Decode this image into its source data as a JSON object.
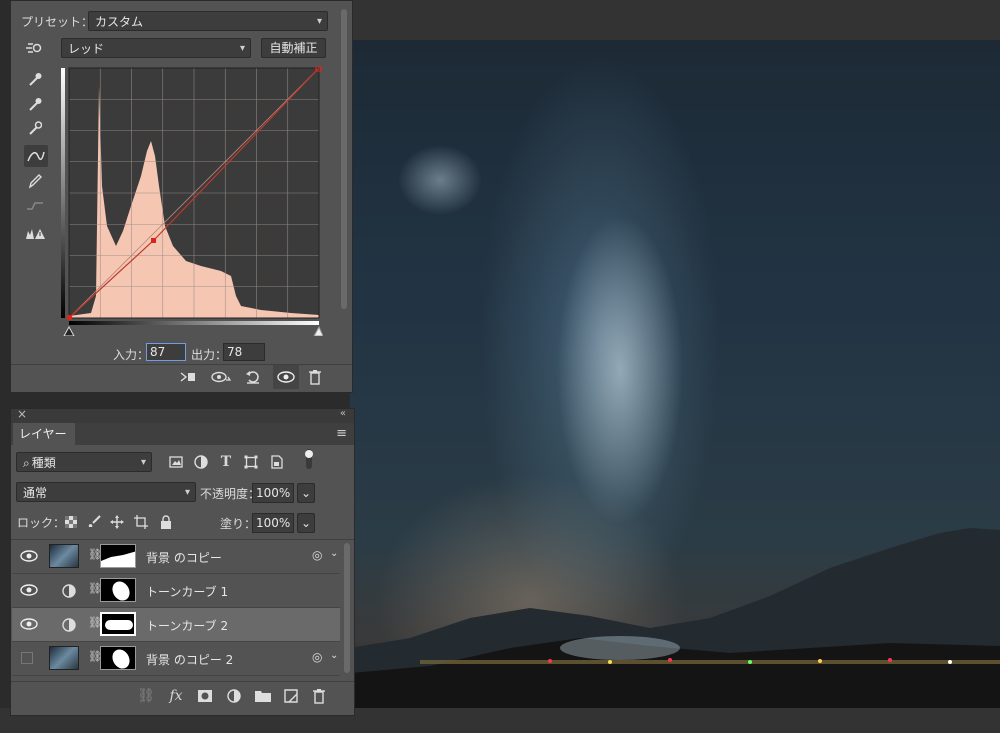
{
  "properties": {
    "preset_label": "プリセット：",
    "preset_value": "カスタム",
    "channel_value": "レッド",
    "auto_button": "自動補正",
    "input_label": "入力：",
    "input_value": "87",
    "output_label": "出力：",
    "output_value": "78"
  },
  "layers_panel": {
    "tab_label": "レイヤー",
    "filter_value": "種類",
    "blend_mode": "通常",
    "opacity_label": "不透明度：",
    "opacity_value": "100%",
    "lock_label": "ロック：",
    "fill_label": "塗り：",
    "fill_value": "100%",
    "layers": [
      {
        "name": "背景 のコピー",
        "visible": true,
        "type": "image"
      },
      {
        "name": "トーンカーブ 1",
        "visible": true,
        "type": "adjustment"
      },
      {
        "name": "トーンカーブ 2",
        "visible": true,
        "type": "adjustment",
        "selected": true
      },
      {
        "name": "背景 のコピー 2",
        "visible": false,
        "type": "image"
      }
    ]
  },
  "colors": {
    "panel_bg": "#535353",
    "histogram_fill": "#f5c6b2",
    "curve_point": "#d9261c"
  }
}
